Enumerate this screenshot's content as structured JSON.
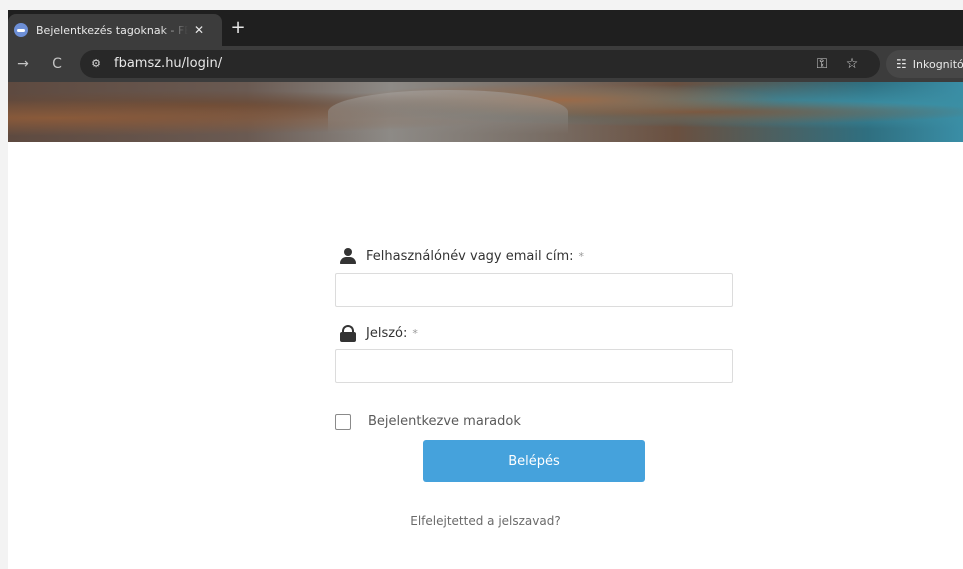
{
  "browser": {
    "tab": {
      "title": "Bejelentkezés tagoknak - FBAMSZ",
      "close_glyph": "✕"
    },
    "new_tab_glyph": "+",
    "toolbar": {
      "back_glyph": "→",
      "reload_glyph": "C",
      "site_info_glyph": "⚙",
      "url": "fbamsz.hu/login/",
      "key_glyph": "⚿",
      "star_glyph": "☆",
      "incognito_label": "Inkognitó"
    }
  },
  "form": {
    "username": {
      "label": "Felhasználónév vagy email cím:",
      "required_mark": "*",
      "value": ""
    },
    "password": {
      "label": "Jelszó:",
      "required_mark": "*",
      "value": ""
    },
    "remember": {
      "label": "Bejelentkezve maradok",
      "checked": false
    },
    "submit_label": "Belépés",
    "forgot_label": "Elfelejtetted a jelszavad?"
  },
  "colors": {
    "accent": "#45a2dc",
    "tab_strip": "#1f1f1f",
    "toolbar": "#3c3c3c"
  }
}
